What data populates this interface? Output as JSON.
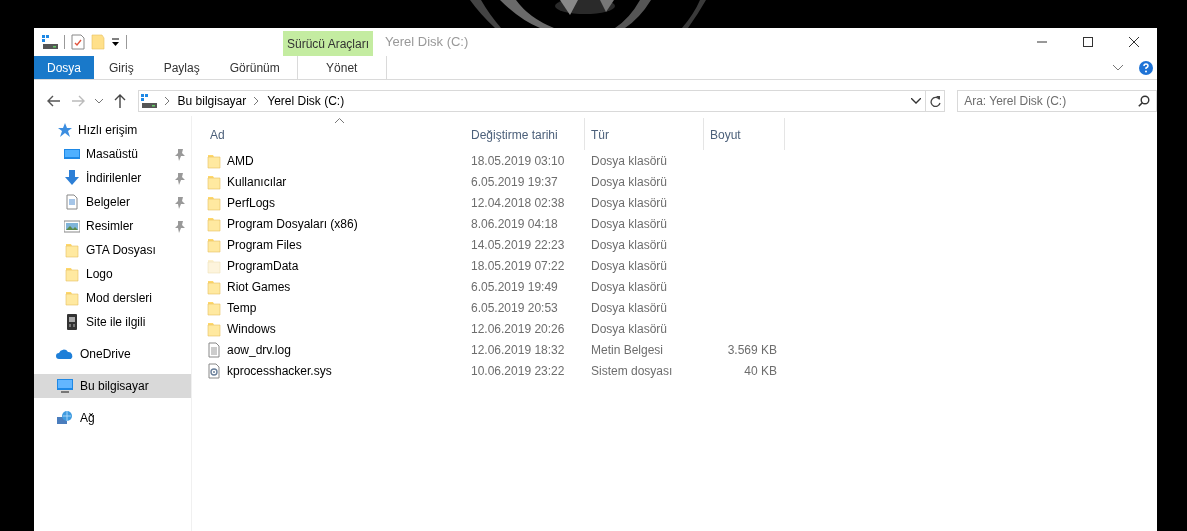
{
  "window": {
    "title": "Yerel Disk (C:)",
    "context_group": "Sürücü Araçları"
  },
  "ribbon_tabs": [
    {
      "label": "Dosya",
      "kind": "file",
      "selected": false
    },
    {
      "label": "Giriş",
      "kind": "tab",
      "selected": false
    },
    {
      "label": "Paylaş",
      "kind": "tab",
      "selected": false
    },
    {
      "label": "Görünüm",
      "kind": "tab",
      "selected": false
    },
    {
      "label": "Yönet",
      "kind": "context",
      "selected": false
    }
  ],
  "address": {
    "path": [
      "Bu bilgisayar",
      "Yerel Disk (C:)"
    ]
  },
  "search": {
    "placeholder": "Ara: Yerel Disk (C:)"
  },
  "nav": [
    {
      "label": "Hızlı erişim",
      "kind": "star",
      "selected": false,
      "children": [
        {
          "label": "Masaüstü",
          "kind": "desktop",
          "pinned": true,
          "selected": false
        },
        {
          "label": "İndirilenler",
          "kind": "download",
          "pinned": true,
          "selected": false
        },
        {
          "label": "Belgeler",
          "kind": "documents",
          "pinned": true,
          "selected": false
        },
        {
          "label": "Resimler",
          "kind": "pictures",
          "pinned": true,
          "selected": false
        },
        {
          "label": "GTA Dosyası",
          "kind": "folder",
          "pinned": false,
          "selected": false
        },
        {
          "label": "Logo",
          "kind": "folder",
          "pinned": false,
          "selected": false
        },
        {
          "label": "Mod dersleri",
          "kind": "folder",
          "pinned": false,
          "selected": false
        },
        {
          "label": "Site ile ilgili",
          "kind": "card",
          "pinned": false,
          "selected": false
        }
      ]
    },
    {
      "label": "OneDrive",
      "kind": "cloud",
      "selected": false
    },
    {
      "label": "Bu bilgisayar",
      "kind": "computer",
      "selected": true
    },
    {
      "label": "Ağ",
      "kind": "network",
      "selected": false
    }
  ],
  "columns": [
    {
      "label": "Ad",
      "sorted": true
    },
    {
      "label": "Değiştirme tarihi",
      "sorted": false
    },
    {
      "label": "Tür",
      "sorted": false
    },
    {
      "label": "Boyut",
      "sorted": false
    }
  ],
  "rows": [
    {
      "name": "AMD",
      "date": "18.05.2019 03:10",
      "type": "Dosya klasörü",
      "kind": "folder"
    },
    {
      "name": "Kullanıcılar",
      "date": "6.05.2019 19:37",
      "type": "Dosya klasörü",
      "kind": "folder"
    },
    {
      "name": "PerfLogs",
      "date": "12.04.2018 02:38",
      "type": "Dosya klasörü",
      "kind": "folder"
    },
    {
      "name": "Program Dosyaları (x86)",
      "date": "8.06.2019 04:18",
      "type": "Dosya klasörü",
      "kind": "folder"
    },
    {
      "name": "Program Files",
      "date": "14.05.2019 22:23",
      "type": "Dosya klasörü",
      "kind": "folder"
    },
    {
      "name": "ProgramData",
      "date": "18.05.2019 07:22",
      "type": "Dosya klasörü",
      "kind": "hidden-folder"
    },
    {
      "name": "Riot Games",
      "date": "6.05.2019 19:49",
      "type": "Dosya klasörü",
      "kind": "folder"
    },
    {
      "name": "Temp",
      "date": "6.05.2019 20:53",
      "type": "Dosya klasörü",
      "kind": "folder"
    },
    {
      "name": "Windows",
      "date": "12.06.2019 20:26",
      "type": "Dosya klasörü",
      "kind": "folder"
    },
    {
      "name": "aow_drv.log",
      "date": "12.06.2019 18:32",
      "type": "Metin Belgesi",
      "size": "3.569 KB",
      "kind": "text"
    },
    {
      "name": "kprocesshacker.sys",
      "date": "10.06.2019 23:22",
      "type": "Sistem dosyası",
      "size": "40 KB",
      "kind": "system"
    }
  ]
}
